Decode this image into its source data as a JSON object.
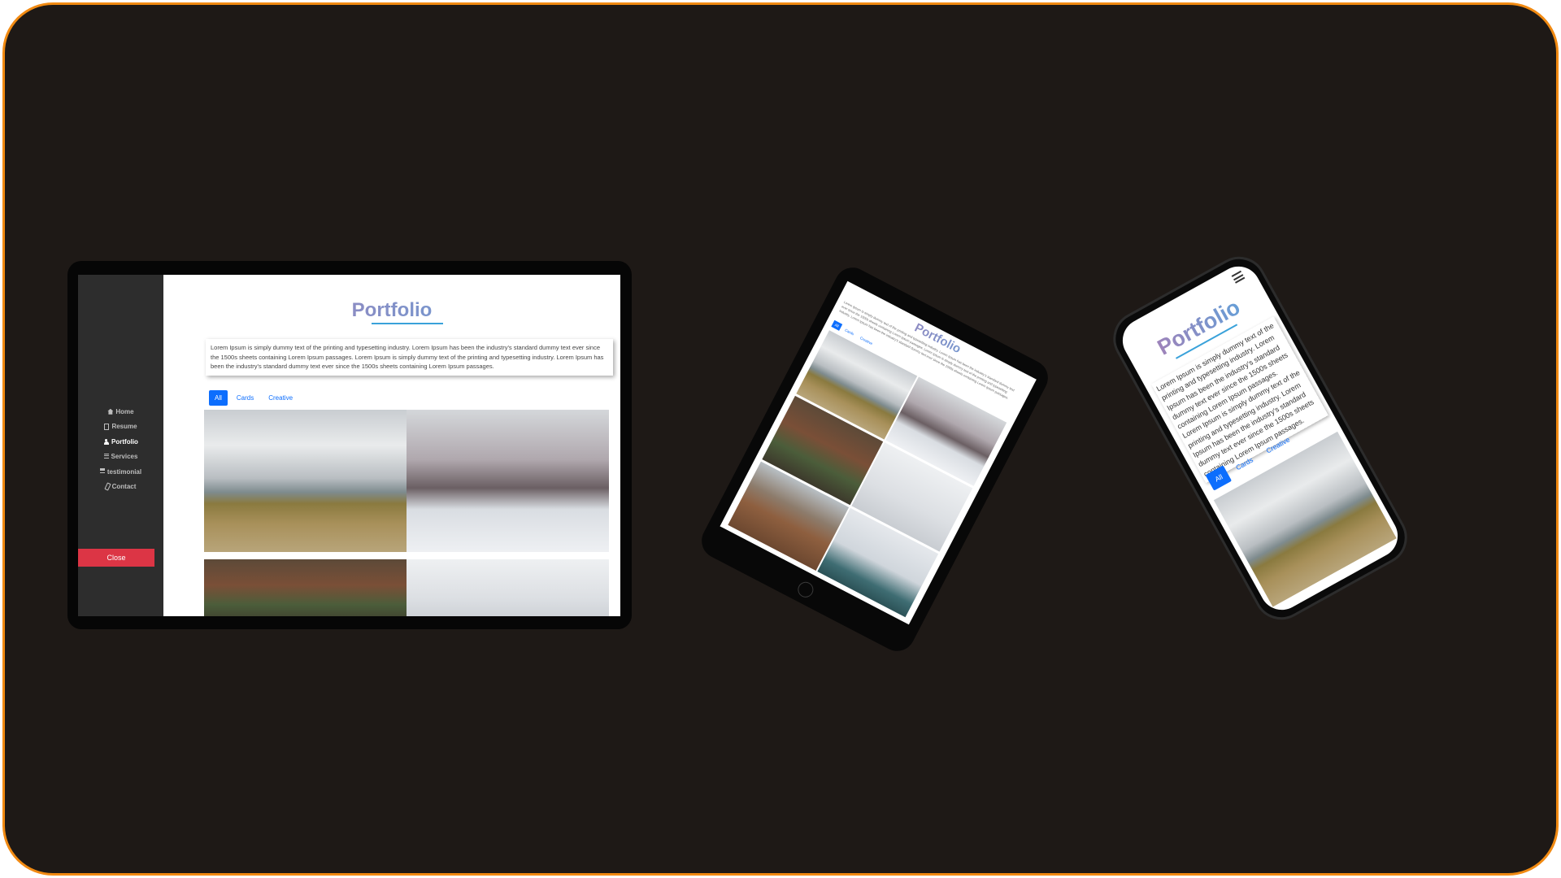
{
  "site": {
    "title": "Portfolio",
    "description": "Lorem Ipsum is simply dummy text of the printing and typesetting industry. Lorem Ipsum has been the industry's standard dummy text ever since the 1500s sheets containing Lorem Ipsum passages. Lorem Ipsum is simply dummy text of the printing and typesetting industry. Lorem Ipsum has been the industry's standard dummy text ever since the 1500s sheets containing Lorem Ipsum passages.",
    "phone_description": "Lorem Ipsum is simply dummy text of the printing and typesetting industry. Lorem Ipsum has been the industry's standard dummy text ever since the 1500s sheets containing Lorem Ipsum passages. Lorem Ipsum is simply dummy text of the printing and typesetting industry. Lorem Ipsum has been the industry's standard dummy text ever since the 1500s sheets containing Lorem Ipsum passages."
  },
  "nav": {
    "items": [
      {
        "label": "Home",
        "icon": "home-icon"
      },
      {
        "label": "Resume",
        "icon": "file-icon"
      },
      {
        "label": "Portfolio",
        "icon": "user-icon",
        "active": true
      },
      {
        "label": "Services",
        "icon": "list-icon"
      },
      {
        "label": "testimonial",
        "icon": "list-icon"
      },
      {
        "label": "Contact",
        "icon": "phone-icon"
      }
    ],
    "close_label": "Close"
  },
  "filters": {
    "all": "All",
    "cards": "Cards",
    "creative": "Creative"
  },
  "colors": {
    "frame_border": "#f18a12",
    "background": "#1e1916",
    "sidebar": "#2d2d2d",
    "close_button": "#dc3545",
    "accent": "#0d6efd",
    "title_underline": "#3aa2da"
  }
}
